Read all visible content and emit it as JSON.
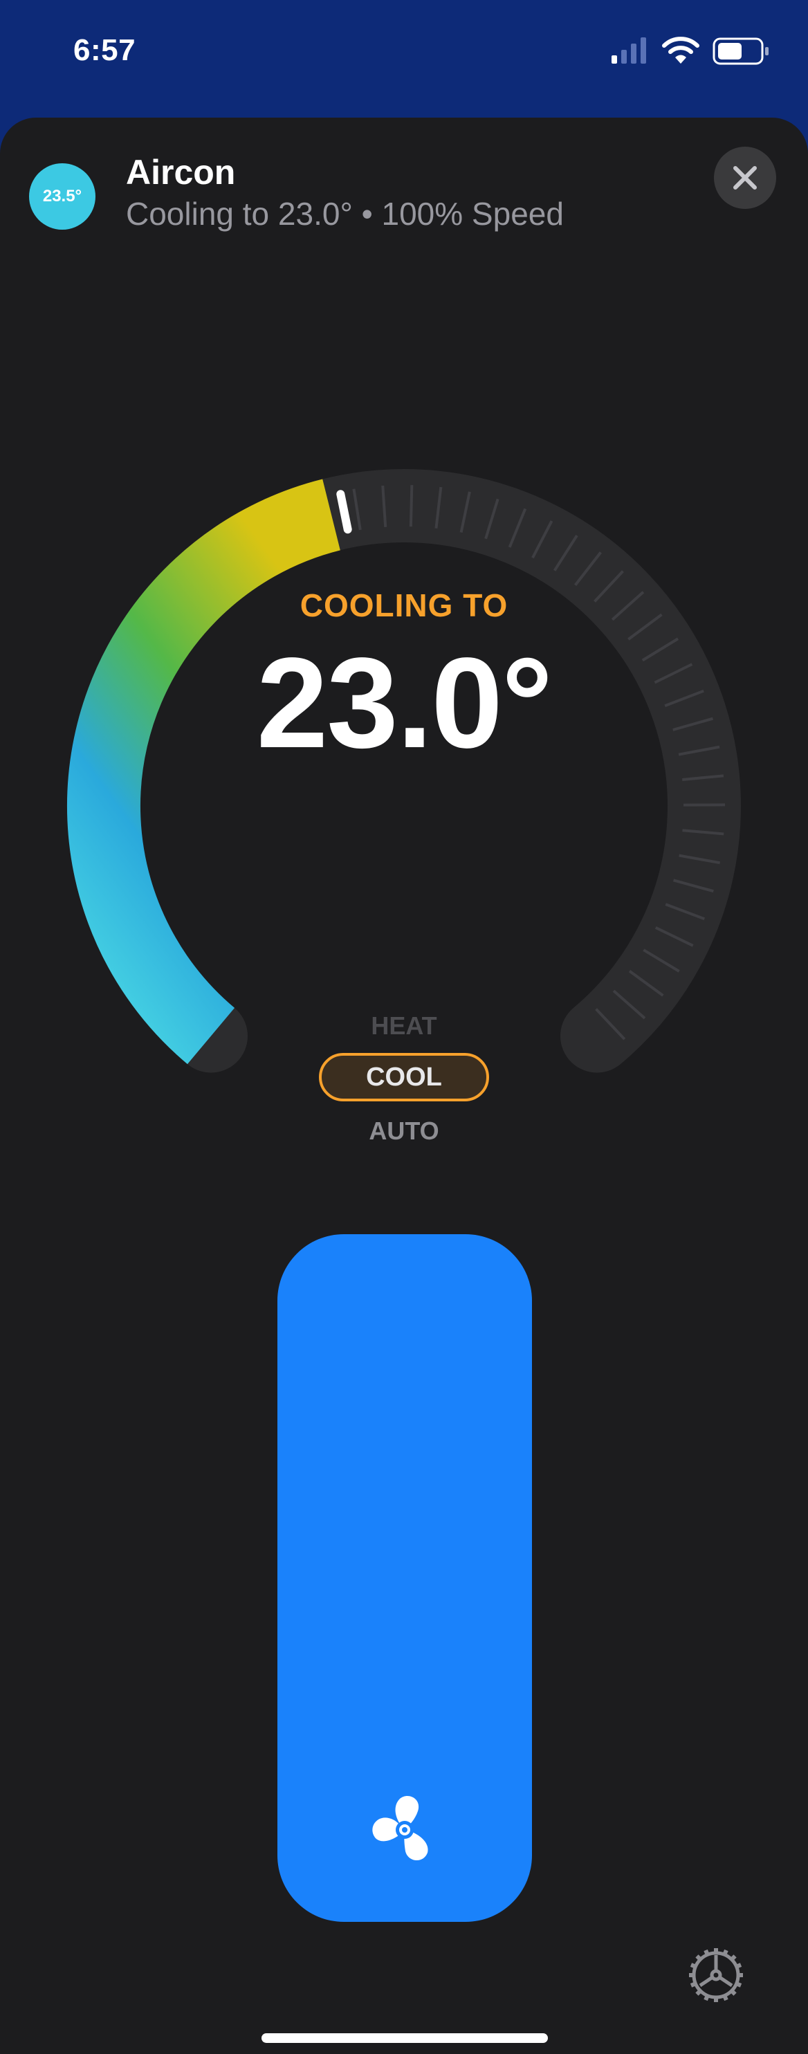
{
  "status_bar": {
    "time": "6:57",
    "icons": [
      "cellular-signal-icon",
      "wifi-icon",
      "battery-icon"
    ]
  },
  "header": {
    "badge": "23.5°",
    "title": "Aircon",
    "subtitle": "Cooling to 23.0° • 100% Speed",
    "close_icon": "close-icon"
  },
  "dial": {
    "label": "COOLING TO",
    "value": "23.0°",
    "fill_fraction": 0.45
  },
  "modes": {
    "heat": "HEAT",
    "cool": "COOL",
    "auto": "AUTO",
    "selected": "COOL"
  },
  "fan": {
    "speed_percent": 100,
    "icon": "fan-icon"
  },
  "settings": {
    "icon": "gear-icon"
  },
  "colors": {
    "header_bg": "#0d2a78",
    "sheet_bg": "#1c1c1e",
    "accent_orange": "#f7a12c",
    "fan_blue": "#1a82fb",
    "badge_cyan": "#3cc9e3"
  }
}
